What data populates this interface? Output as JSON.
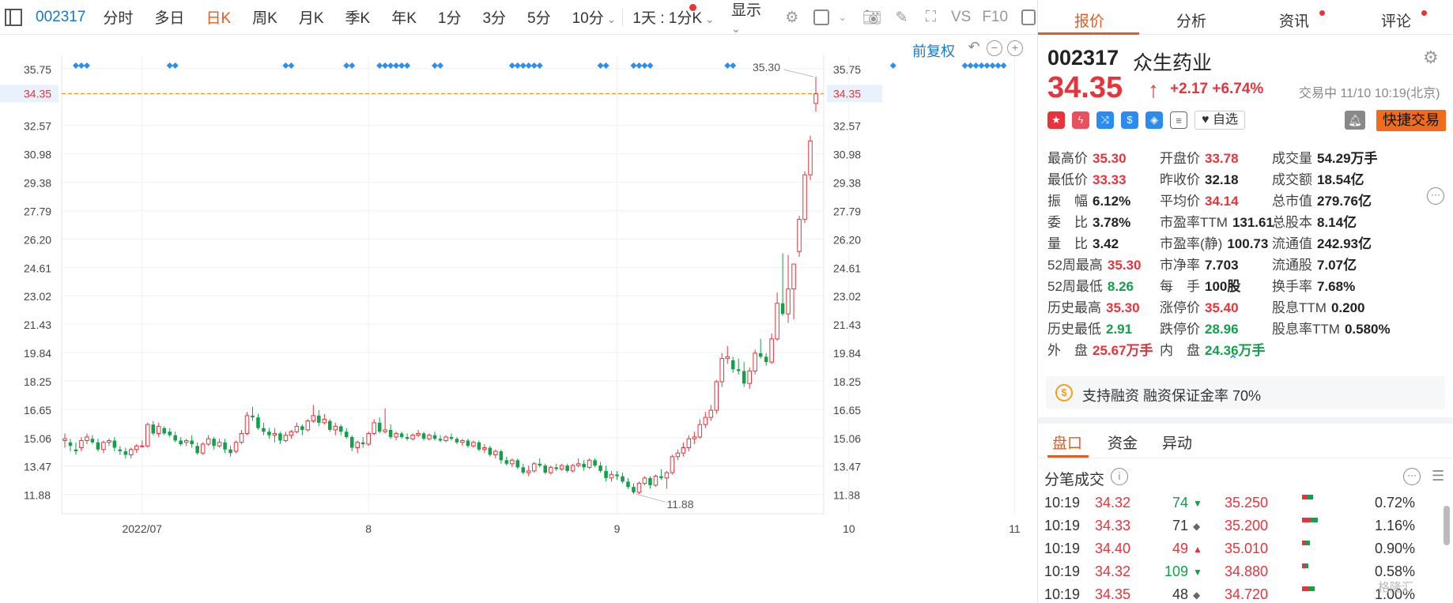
{
  "toolbar": {
    "code": "002317",
    "periods": [
      "分时",
      "多日",
      "日K",
      "周K",
      "月K",
      "季K",
      "年K",
      "1分",
      "3分",
      "5分",
      "10分"
    ],
    "active_period": "日K",
    "range_label": "1天 : 1分K",
    "display_label": "显示",
    "vs_label": "VS",
    "f10_label": "F10"
  },
  "chart": {
    "fuquan_label": "前复权",
    "y_ticks": [
      "35.75",
      "32.57",
      "30.98",
      "29.38",
      "27.79",
      "26.20",
      "24.61",
      "23.02",
      "21.43",
      "19.84",
      "18.25",
      "16.65",
      "15.06",
      "13.47",
      "11.88"
    ],
    "current_price_tag": "34.35",
    "high_label": "35.30",
    "low_label": "11.88",
    "x_labels": [
      "2022/07",
      "8",
      "9",
      "10",
      "11"
    ]
  },
  "chart_data": {
    "type": "candlestick",
    "ylim": [
      10.8,
      36.5
    ],
    "reference_line": 34.35,
    "x_label_index": [
      14,
      55,
      100,
      142,
      172
    ],
    "marker_index": [
      2,
      3,
      4,
      19,
      20,
      40,
      41,
      51,
      52,
      57,
      58,
      59,
      60,
      61,
      62,
      67,
      68,
      81,
      82,
      83,
      84,
      85,
      86,
      97,
      98,
      103,
      104,
      105,
      106,
      120,
      121,
      150,
      163,
      164,
      165,
      166,
      167,
      168,
      169,
      170,
      180,
      181,
      185,
      186,
      195,
      196,
      200,
      201,
      202
    ],
    "candles": [
      [
        14.9,
        15.3,
        14.5,
        15.0
      ],
      [
        14.8,
        15.0,
        14.3,
        14.6
      ],
      [
        14.4,
        14.8,
        14.1,
        14.3
      ],
      [
        14.5,
        15.1,
        14.3,
        14.9
      ],
      [
        14.9,
        15.3,
        14.7,
        15.1
      ],
      [
        15.0,
        15.2,
        14.7,
        14.8
      ],
      [
        14.8,
        15.0,
        14.3,
        14.4
      ],
      [
        14.4,
        14.9,
        14.2,
        14.8
      ],
      [
        14.8,
        15.0,
        14.6,
        14.9
      ],
      [
        14.9,
        15.1,
        14.3,
        14.5
      ],
      [
        14.4,
        14.6,
        14.1,
        14.3
      ],
      [
        14.3,
        14.5,
        13.9,
        14.1
      ],
      [
        14.1,
        14.5,
        13.9,
        14.4
      ],
      [
        14.4,
        14.7,
        14.2,
        14.6
      ],
      [
        14.6,
        14.9,
        14.5,
        14.6
      ],
      [
        14.6,
        15.9,
        14.5,
        15.8
      ],
      [
        15.8,
        16.0,
        15.2,
        15.3
      ],
      [
        15.3,
        15.9,
        15.1,
        15.7
      ],
      [
        15.6,
        15.7,
        15.2,
        15.3
      ],
      [
        15.4,
        15.6,
        15.1,
        15.2
      ],
      [
        15.2,
        15.4,
        14.8,
        14.9
      ],
      [
        14.9,
        15.1,
        14.6,
        14.7
      ],
      [
        14.8,
        15.0,
        14.6,
        14.9
      ],
      [
        14.9,
        15.2,
        14.5,
        14.7
      ],
      [
        14.6,
        14.8,
        14.1,
        14.2
      ],
      [
        14.2,
        14.8,
        14.1,
        14.7
      ],
      [
        14.7,
        15.2,
        14.6,
        15.0
      ],
      [
        15.0,
        15.1,
        14.4,
        14.6
      ],
      [
        14.6,
        15.0,
        14.5,
        14.8
      ],
      [
        14.8,
        15.0,
        14.2,
        14.4
      ],
      [
        14.4,
        14.6,
        14.0,
        14.2
      ],
      [
        14.3,
        14.9,
        14.2,
        14.8
      ],
      [
        14.8,
        15.5,
        14.7,
        15.3
      ],
      [
        15.3,
        16.5,
        15.2,
        16.3
      ],
      [
        16.3,
        16.8,
        16.0,
        16.2
      ],
      [
        16.2,
        16.4,
        15.5,
        15.6
      ],
      [
        15.6,
        15.9,
        15.2,
        15.4
      ],
      [
        15.4,
        15.6,
        15.0,
        15.2
      ],
      [
        15.2,
        15.6,
        14.8,
        15.3
      ],
      [
        15.3,
        15.4,
        14.7,
        14.9
      ],
      [
        14.9,
        15.4,
        14.8,
        15.2
      ],
      [
        15.2,
        15.5,
        15.0,
        15.4
      ],
      [
        15.4,
        15.9,
        15.3,
        15.7
      ],
      [
        15.7,
        15.8,
        15.2,
        15.5
      ],
      [
        15.5,
        16.1,
        15.4,
        16.0
      ],
      [
        16.0,
        16.9,
        15.9,
        16.3
      ],
      [
        16.3,
        16.6,
        15.7,
        15.9
      ],
      [
        15.9,
        16.4,
        15.8,
        16.1
      ],
      [
        16.0,
        16.1,
        15.4,
        15.5
      ],
      [
        15.5,
        15.9,
        15.2,
        15.7
      ],
      [
        15.7,
        15.8,
        15.2,
        15.4
      ],
      [
        15.4,
        15.6,
        15.0,
        15.1
      ],
      [
        15.1,
        15.2,
        14.3,
        14.5
      ],
      [
        14.5,
        14.9,
        14.2,
        14.8
      ],
      [
        14.8,
        15.1,
        14.5,
        14.7
      ],
      [
        14.7,
        15.4,
        14.6,
        15.3
      ],
      [
        15.3,
        16.1,
        15.2,
        15.9
      ],
      [
        15.9,
        16.2,
        15.3,
        15.4
      ],
      [
        15.4,
        16.7,
        15.3,
        15.5
      ],
      [
        15.5,
        15.8,
        15.0,
        15.1
      ],
      [
        15.1,
        15.4,
        14.9,
        15.3
      ],
      [
        15.3,
        15.4,
        15.0,
        15.1
      ],
      [
        15.1,
        15.3,
        14.9,
        15.0
      ],
      [
        15.0,
        15.3,
        14.9,
        15.2
      ],
      [
        15.2,
        15.5,
        15.1,
        15.3
      ],
      [
        15.3,
        15.4,
        14.9,
        15.0
      ],
      [
        15.0,
        15.3,
        14.9,
        15.2
      ],
      [
        15.2,
        15.4,
        14.9,
        15.0
      ],
      [
        15.0,
        15.2,
        14.8,
        14.9
      ],
      [
        14.9,
        15.2,
        14.8,
        15.1
      ],
      [
        15.1,
        15.3,
        14.9,
        15.0
      ],
      [
        15.0,
        15.1,
        14.7,
        14.8
      ],
      [
        14.8,
        15.0,
        14.6,
        14.9
      ],
      [
        14.9,
        15.0,
        14.5,
        14.6
      ],
      [
        14.6,
        14.9,
        14.5,
        14.8
      ],
      [
        14.8,
        14.9,
        14.3,
        14.4
      ],
      [
        14.4,
        14.7,
        14.2,
        14.5
      ],
      [
        14.5,
        14.6,
        14.0,
        14.1
      ],
      [
        14.1,
        14.4,
        13.9,
        14.3
      ],
      [
        14.3,
        14.4,
        13.6,
        13.8
      ],
      [
        13.8,
        14.0,
        13.5,
        13.6
      ],
      [
        13.6,
        13.9,
        13.4,
        13.8
      ],
      [
        13.8,
        13.9,
        13.3,
        13.4
      ],
      [
        13.4,
        13.6,
        13.0,
        13.1
      ],
      [
        13.1,
        13.5,
        12.9,
        13.2
      ],
      [
        13.2,
        13.7,
        13.1,
        13.6
      ],
      [
        13.6,
        13.9,
        13.4,
        13.5
      ],
      [
        13.5,
        13.6,
        13.0,
        13.1
      ],
      [
        13.1,
        13.5,
        13.0,
        13.4
      ],
      [
        13.4,
        13.6,
        13.2,
        13.3
      ],
      [
        13.3,
        13.6,
        13.2,
        13.5
      ],
      [
        13.5,
        13.6,
        13.1,
        13.2
      ],
      [
        13.2,
        13.6,
        13.1,
        13.5
      ],
      [
        13.5,
        13.9,
        13.4,
        13.6
      ],
      [
        13.6,
        13.8,
        13.2,
        13.4
      ],
      [
        13.4,
        13.9,
        13.3,
        13.8
      ],
      [
        13.8,
        13.9,
        13.4,
        13.5
      ],
      [
        13.5,
        13.7,
        13.1,
        13.2
      ],
      [
        13.2,
        13.5,
        12.6,
        12.8
      ],
      [
        12.8,
        13.2,
        12.6,
        13.0
      ],
      [
        13.0,
        13.2,
        12.7,
        12.9
      ],
      [
        12.9,
        13.1,
        12.5,
        12.6
      ],
      [
        12.6,
        12.8,
        12.2,
        12.3
      ],
      [
        12.3,
        12.5,
        11.9,
        12.0
      ],
      [
        12.0,
        12.6,
        11.9,
        12.5
      ],
      [
        12.5,
        12.9,
        12.4,
        12.8
      ],
      [
        12.8,
        12.9,
        12.2,
        12.4
      ],
      [
        12.4,
        13.0,
        12.3,
        12.9
      ],
      [
        12.9,
        13.3,
        12.7,
        12.8
      ],
      [
        12.8,
        13.2,
        12.2,
        13.1
      ],
      [
        13.1,
        14.1,
        13.0,
        14.0
      ],
      [
        14.0,
        14.4,
        13.8,
        14.2
      ],
      [
        14.2,
        14.8,
        14.0,
        14.5
      ],
      [
        14.5,
        15.2,
        14.3,
        15.0
      ],
      [
        15.0,
        15.4,
        14.7,
        15.1
      ],
      [
        15.1,
        16.1,
        15.0,
        15.8
      ],
      [
        15.8,
        16.5,
        15.6,
        16.2
      ],
      [
        16.2,
        16.9,
        16.0,
        16.6
      ],
      [
        16.6,
        18.3,
        16.4,
        18.2
      ],
      [
        18.2,
        19.8,
        17.9,
        19.5
      ],
      [
        19.5,
        20.2,
        19.2,
        19.6
      ],
      [
        19.4,
        19.6,
        18.7,
        18.9
      ],
      [
        18.9,
        19.5,
        18.6,
        18.8
      ],
      [
        18.8,
        19.3,
        17.9,
        18.1
      ],
      [
        18.1,
        19.0,
        17.8,
        18.8
      ],
      [
        18.8,
        20.0,
        18.6,
        19.8
      ],
      [
        19.8,
        20.6,
        19.5,
        19.6
      ],
      [
        19.6,
        19.8,
        19.1,
        19.3
      ],
      [
        19.3,
        20.9,
        19.2,
        20.6
      ],
      [
        20.6,
        23.2,
        20.5,
        22.6
      ],
      [
        22.6,
        25.4,
        21.9,
        22.0
      ],
      [
        22.0,
        25.3,
        21.5,
        23.4
      ],
      [
        23.4,
        24.8,
        21.7,
        24.8
      ],
      [
        25.5,
        27.5,
        25.2,
        27.3
      ],
      [
        27.3,
        30.0,
        27.1,
        29.8
      ],
      [
        29.8,
        32.0,
        29.5,
        31.7
      ],
      [
        33.8,
        35.3,
        33.33,
        34.35
      ]
    ]
  },
  "panel": {
    "tabs": [
      "报价",
      "分析",
      "资讯",
      "评论"
    ],
    "code": "002317",
    "name": "众生药业",
    "price": "34.35",
    "change": "+2.17",
    "change_pct": "+6.74%",
    "status": "交易中 11/10 10:19(北京)",
    "zixuan": "自选",
    "quick_trade": "快捷交易",
    "quote": [
      [
        [
          "最高价",
          "35.30",
          "red"
        ],
        [
          "开盘价",
          "33.78",
          "red"
        ],
        [
          "成交量",
          "54.29万手",
          "black"
        ]
      ],
      [
        [
          "最低价",
          "33.33",
          "red"
        ],
        [
          "昨收价",
          "32.18",
          "black"
        ],
        [
          "成交额",
          "18.54亿",
          "black"
        ]
      ],
      [
        [
          "振　幅",
          "6.12%",
          "black"
        ],
        [
          "平均价",
          "34.14",
          "red"
        ],
        [
          "总市值",
          "279.76亿",
          "black"
        ]
      ],
      [
        [
          "委　比",
          "3.78%",
          "black"
        ],
        [
          "市盈率TTM",
          "131.61",
          "black"
        ],
        [
          "总股本",
          "8.14亿",
          "black"
        ]
      ],
      [
        [
          "量　比",
          "3.42",
          "black"
        ],
        [
          "市盈率(静)",
          "100.73",
          "black"
        ],
        [
          "流通值",
          "242.93亿",
          "black"
        ]
      ],
      [
        [
          "52周最高",
          "35.30",
          "red"
        ],
        [
          "市净率",
          "7.703",
          "black"
        ],
        [
          "流通股",
          "7.07亿",
          "black"
        ]
      ],
      [
        [
          "52周最低",
          "8.26",
          "green"
        ],
        [
          "每　手",
          "100股",
          "black"
        ],
        [
          "换手率",
          "7.68%",
          "black"
        ]
      ],
      [
        [
          "历史最高",
          "35.30",
          "red"
        ],
        [
          "涨停价",
          "35.40",
          "red"
        ],
        [
          "股息TTM",
          "0.200",
          "black"
        ]
      ],
      [
        [
          "历史最低",
          "2.91",
          "green"
        ],
        [
          "跌停价",
          "28.96",
          "green"
        ],
        [
          "股息率TTM",
          "0.580%",
          "black"
        ]
      ],
      [
        [
          "外　盘",
          "25.67万手",
          "red"
        ],
        [
          "内　盘",
          "24.36万手",
          "green"
        ],
        [
          "",
          "",
          "black"
        ]
      ]
    ],
    "margin_text": "支持融资 融资保证金率 70%",
    "margin_icon": "$",
    "subtabs": [
      "盘口",
      "资金",
      "异动"
    ],
    "ticks_title": "分笔成交",
    "ticks": [
      [
        "10:19",
        "34.32",
        "74",
        "down",
        "35.250",
        "0.72%"
      ],
      [
        "10:19",
        "34.33",
        "71",
        "flat",
        "35.200",
        "1.16%"
      ],
      [
        "10:19",
        "34.40",
        "49",
        "up",
        "35.010",
        "0.90%"
      ],
      [
        "10:19",
        "34.32",
        "109",
        "down",
        "34.880",
        "0.58%"
      ],
      [
        "10:19",
        "34.35",
        "48",
        "flat",
        "34.720",
        "1.00%"
      ]
    ],
    "watermark": "格隆汇"
  },
  "colors": {
    "up": "#e8333b",
    "down": "#13a04a",
    "accent": "#e65a1f",
    "link": "#1677d2",
    "marker": "#2b8ff0"
  }
}
